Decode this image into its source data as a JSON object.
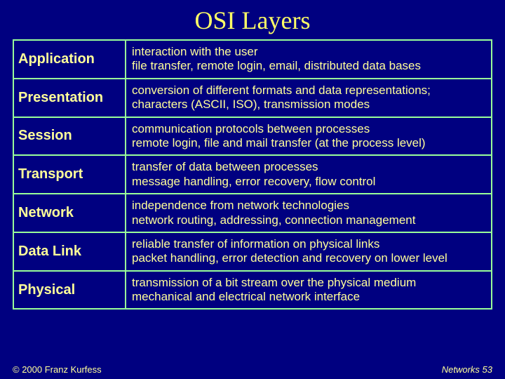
{
  "title": "OSI Layers",
  "layers": [
    {
      "name": "Application",
      "line1": "interaction with the user",
      "line2": "file transfer, remote login, email, distributed data bases"
    },
    {
      "name": "Presentation",
      "line1": "conversion of different formats and data representations;",
      "line2": "characters (ASCII, ISO), transmission modes"
    },
    {
      "name": "Session",
      "line1": "communication protocols between processes",
      "line2": "remote login, file and mail transfer (at the process level)"
    },
    {
      "name": "Transport",
      "line1": "transfer of data between processes",
      "line2": "message handling, error recovery, flow control"
    },
    {
      "name": "Network",
      "line1": "independence from network technologies",
      "line2": "network routing, addressing, connection management"
    },
    {
      "name": "Data Link",
      "line1": "reliable transfer of information on physical links",
      "line2": "packet handling, error detection and recovery on lower level"
    },
    {
      "name": "Physical",
      "line1": "transmission of a bit stream over the physical medium",
      "line2": "mechanical and electrical network interface"
    }
  ],
  "footer": {
    "copyright": "© 2000 Franz Kurfess",
    "page_label": "Networks  53"
  }
}
